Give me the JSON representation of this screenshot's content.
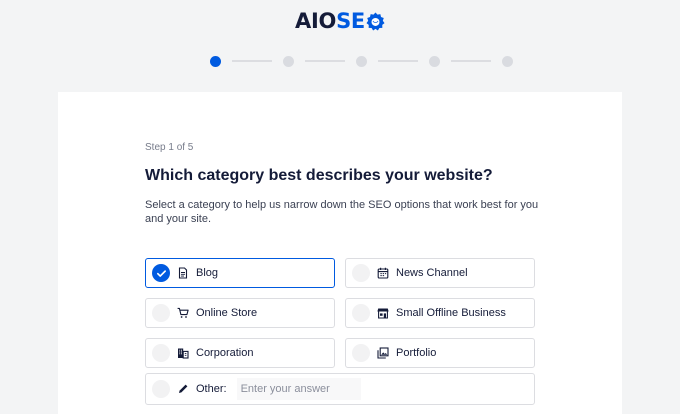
{
  "logo": {
    "part1": "AIO",
    "part2": "SE"
  },
  "stepper": {
    "total": 5,
    "current": 1
  },
  "step_label": "Step 1 of 5",
  "title": "Which category best describes your website?",
  "description": "Select a category to help us narrow down the SEO options that work best for you and your site.",
  "options": [
    {
      "label": "Blog",
      "icon": "document-icon",
      "selected": true
    },
    {
      "label": "News Channel",
      "icon": "calendar-icon",
      "selected": false
    },
    {
      "label": "Online Store",
      "icon": "cart-icon",
      "selected": false
    },
    {
      "label": "Small Offline Business",
      "icon": "store-icon",
      "selected": false
    },
    {
      "label": "Corporation",
      "icon": "building-icon",
      "selected": false
    },
    {
      "label": "Portfolio",
      "icon": "gallery-icon",
      "selected": false
    }
  ],
  "other": {
    "label": "Other:",
    "icon": "pencil-icon",
    "placeholder": "Enter your answer",
    "value": ""
  },
  "colors": {
    "accent": "#005ae0",
    "text": "#141b38",
    "border": "#dcdde1",
    "background": "#f3f4f5"
  }
}
